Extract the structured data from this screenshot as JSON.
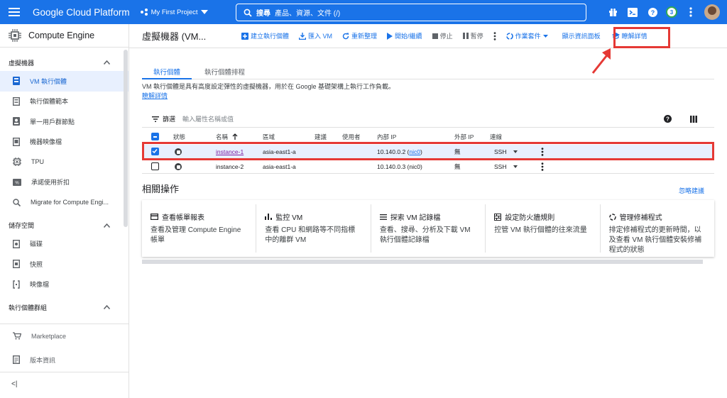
{
  "topbar": {
    "brand": "Google Cloud Platform",
    "project": "My First Project",
    "search_label": "搜尋",
    "search_placeholder": "產品、資源、文件 (/)",
    "notification_count": "3"
  },
  "sidebar": {
    "product": "Compute Engine",
    "sections": [
      {
        "title": "虛擬機器",
        "items": [
          "VM 執行個體",
          "執行個體範本",
          "單一用戶群節點",
          "機器映像檔",
          "TPU",
          "承諾使用折扣",
          "Migrate for Compute Engi..."
        ]
      },
      {
        "title": "儲存空間",
        "items": [
          "磁碟",
          "快照",
          "映像檔"
        ]
      },
      {
        "title": "執行個體群組",
        "items": []
      }
    ],
    "bottom": [
      "Marketplace",
      "版本資訊"
    ],
    "collapse_glyph": "<|"
  },
  "toolbar": {
    "title": "虛擬機器 (VM...",
    "create": "建立執行個體",
    "import": "匯入 VM",
    "refresh": "重新整理",
    "start": "開始/繼續",
    "stop": "停止",
    "suspend": "暫停",
    "ops": "作業套件",
    "show_info": "顯示資訊面板",
    "learn": "瞭解詳情"
  },
  "tabs": [
    "執行個體",
    "執行個體排程"
  ],
  "description": {
    "text": "VM 執行個體是具有高度設定彈性的虛擬機器，用於在 Google 基礎架構上執行工作負載。",
    "link": "瞭解詳情"
  },
  "filter": {
    "label": "篩選",
    "placeholder": "輸入屬性名稱或值"
  },
  "table": {
    "headers": {
      "status": "狀態",
      "name": "名稱",
      "zone": "區域",
      "recommend": "建議",
      "used_by": "使用者",
      "internal_ip": "內部 IP",
      "external_ip": "外部 IP",
      "connect": "連線"
    },
    "rows": [
      {
        "name": "instance-1",
        "zone": "asia-east1-a",
        "ip": "10.140.0.2",
        "nic": "nic0",
        "external": "無",
        "connect": "SSH",
        "checked": true
      },
      {
        "name": "instance-2",
        "zone": "asia-east1-a",
        "ip": "10.140.0.3",
        "nic": "nic0",
        "external": "無",
        "connect": "SSH",
        "checked": false
      }
    ]
  },
  "related": {
    "title": "相關操作",
    "dismiss": "忽略建議",
    "cards": [
      {
        "title": "查看帳單報表",
        "desc": "查看及管理 Compute Engine 帳單"
      },
      {
        "title": "監控 VM",
        "desc": "查看 CPU 和網路等不同指標中的離群 VM"
      },
      {
        "title": "探索 VM 記錄檔",
        "desc": "查看、搜尋、分析及下載 VM 執行個體記錄檔"
      },
      {
        "title": "設定防火牆規則",
        "desc": "控管 VM 執行個體的往來流量"
      },
      {
        "title": "管理修補程式",
        "desc": "排定修補程式的更新時間，以及查看 VM 執行個體安裝修補程式的狀態"
      }
    ]
  },
  "colors": {
    "primary": "#1a73e8",
    "highlight": "#e53935",
    "active_bg": "#e8f0fe"
  }
}
